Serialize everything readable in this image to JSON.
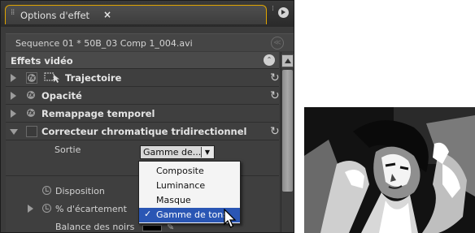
{
  "panel": {
    "tab_title": "Options d'effet",
    "tab_close": "×",
    "sequence_label": "Sequence 01 * 50B_03 Comp 1_004.avi",
    "section_title": "Effets vidéo"
  },
  "effects": [
    {
      "label": "Trajectoire"
    },
    {
      "label": "Opacité"
    },
    {
      "label": "Remappage temporel"
    },
    {
      "label": "Correcteur chromatique tridirectionnel"
    }
  ],
  "properties": {
    "output_label": "Sortie",
    "layout_label": "Disposition",
    "spread_label": "% d'écartement",
    "black_balance_label": "Balance des noirs"
  },
  "dropdown": {
    "selected": "Gamme de...",
    "options": [
      "Composite",
      "Luminance",
      "Masque",
      "Gamme de tons"
    ],
    "checked_option": "Gamme de tons"
  },
  "icons": {
    "menu": "panel-menu-icon",
    "reset": "reset-icon",
    "collapse": "collapse-icon"
  },
  "colors": {
    "tab_accent": "#e0a500",
    "selection": "#2a56b4"
  }
}
